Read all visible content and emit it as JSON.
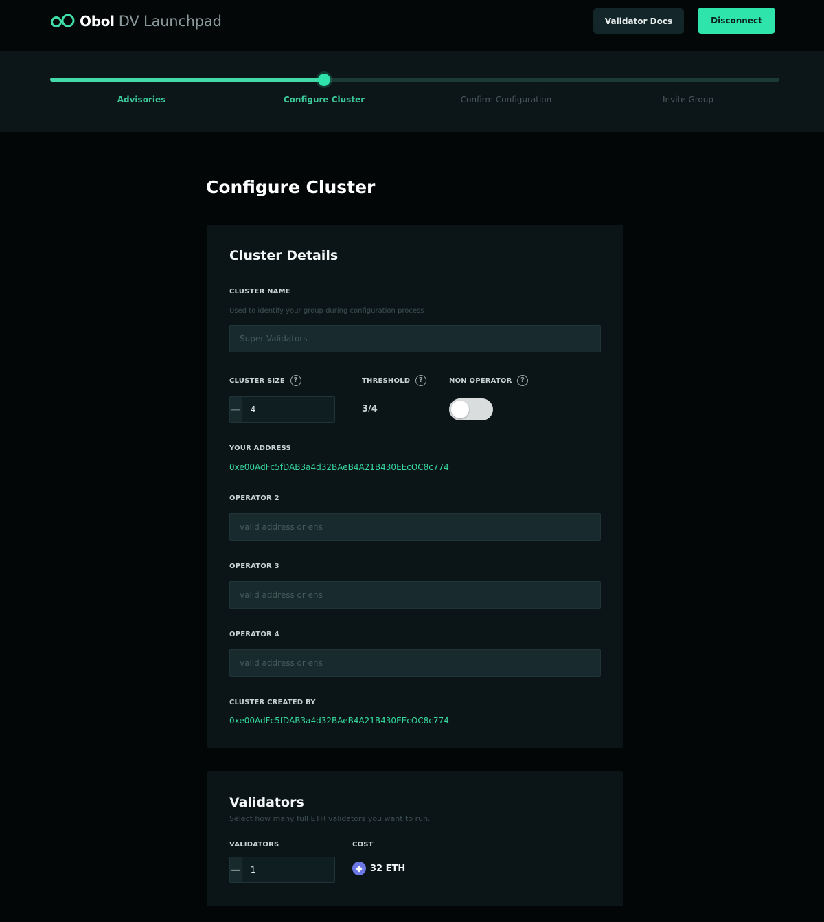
{
  "header": {
    "brand_name": "Obol",
    "product_name": "DV Launchpad",
    "docs_label": "Validator Docs",
    "disconnect_label": "Disconnect"
  },
  "stepper": {
    "steps": [
      {
        "label": "Advisories",
        "state": "done"
      },
      {
        "label": "Configure Cluster",
        "state": "active"
      },
      {
        "label": "Confirm Configuration",
        "state": "todo"
      },
      {
        "label": "Invite Group",
        "state": "todo"
      }
    ],
    "progress_fraction": 0.375
  },
  "page": {
    "title": "Configure Cluster"
  },
  "cluster_details": {
    "title": "Cluster Details",
    "cluster_name_label": "CLUSTER NAME",
    "cluster_name_help": "Used to identify your group during configuration process",
    "cluster_name_placeholder": "Super Validators",
    "cluster_size_label": "CLUSTER SIZE",
    "cluster_size_value": "4",
    "threshold_label": "THRESHOLD",
    "threshold_value": "3/4",
    "non_operator_label": "NON OPERATOR",
    "non_operator_enabled": false,
    "your_address_label": "YOUR ADDRESS",
    "your_address": "0xe00AdFc5fDAB3a4d32BAeB4A21B430EEcOC8c774",
    "operators": [
      {
        "label": "OPERATOR 2",
        "placeholder": "valid address or ens"
      },
      {
        "label": "OPERATOR 3",
        "placeholder": "valid address or ens"
      },
      {
        "label": "OPERATOR 4",
        "placeholder": "valid address or ens"
      }
    ],
    "created_by_label": "CLUSTER CREATED BY",
    "created_by": "0xe00AdFc5fDAB3a4d32BAeB4A21B430EEcOC8c774"
  },
  "validators": {
    "title": "Validators",
    "help": "Select how many full ETH validators you want to run.",
    "validators_label": "VALIDATORS",
    "validators_value": "1",
    "cost_label": "COST",
    "cost_value": "32 ETH"
  },
  "icons": {
    "logo": "infinity-logo-icon",
    "help": "question-circle-icon",
    "eth": "ethereum-icon",
    "minus": "minus-icon",
    "plus": "plus-icon"
  },
  "colors": {
    "accent": "#2fe4ab",
    "address": "#36d89e",
    "background": "#030607",
    "card": "#0b1517"
  }
}
